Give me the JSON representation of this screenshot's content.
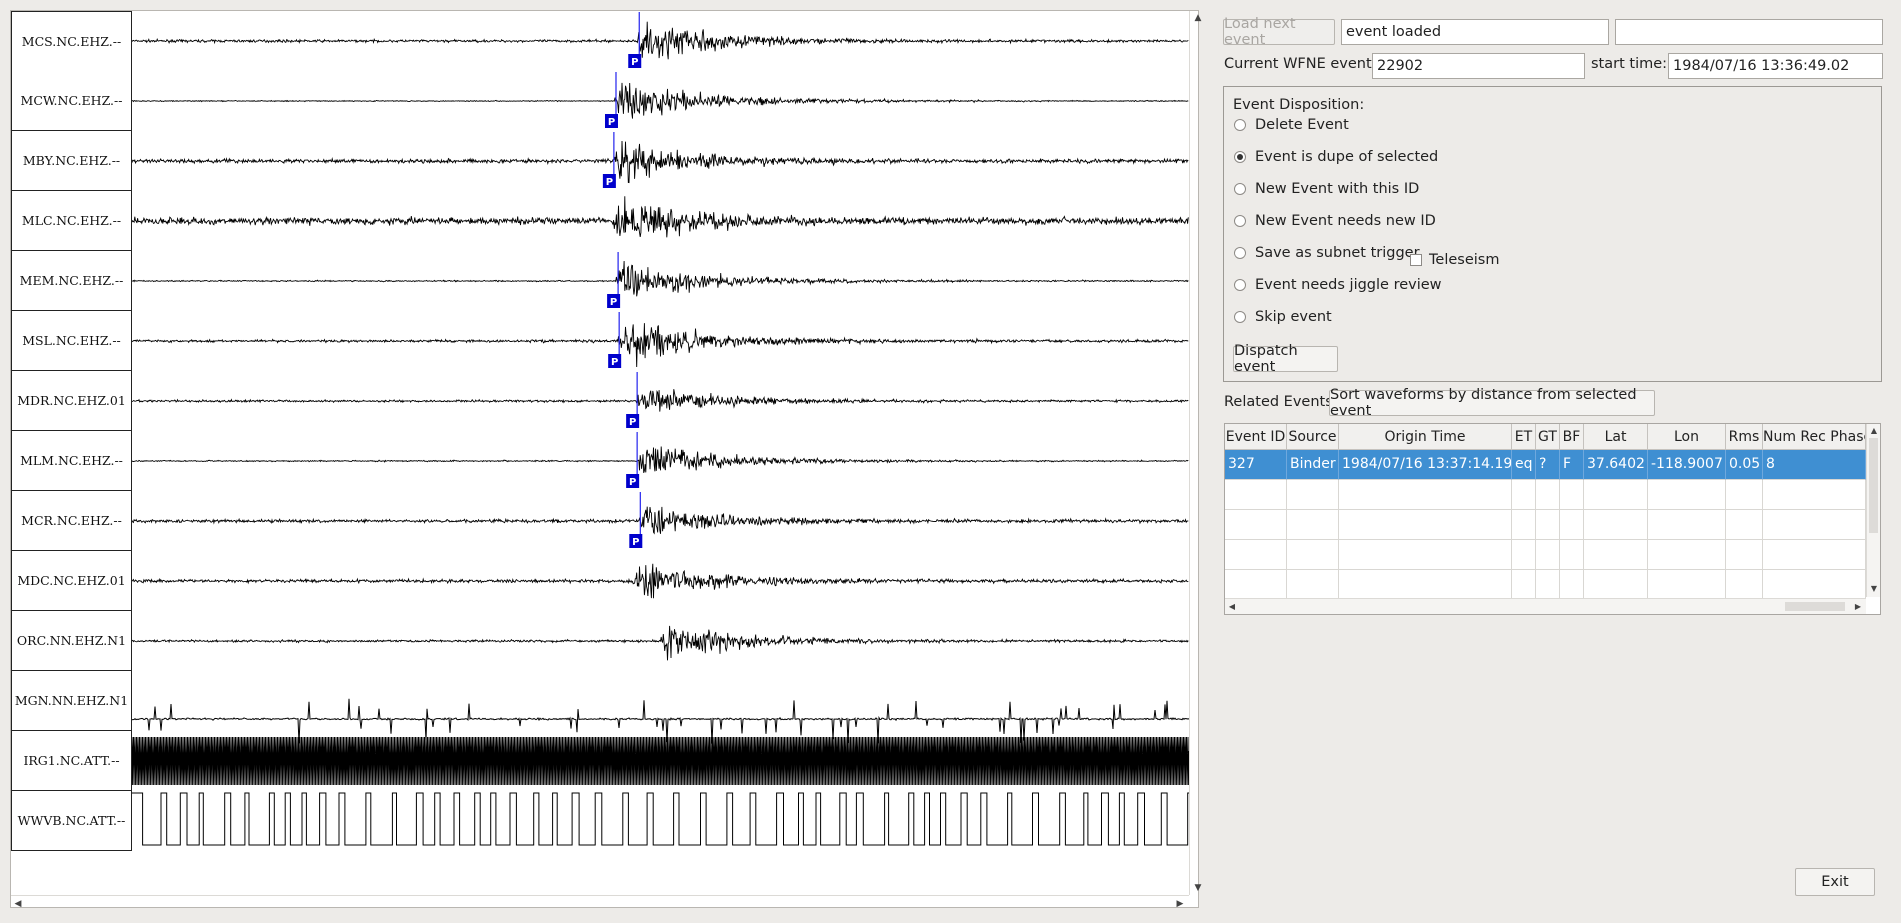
{
  "waveforms": {
    "stations": [
      {
        "label": "MCS.NC.EHZ.--",
        "pick": "P",
        "pick_time": 0.478,
        "onset": 0.478,
        "noise": 0.08,
        "amp": 0.9,
        "style": "quake"
      },
      {
        "label": "MCW.NC.EHZ.--",
        "pick": "P",
        "pick_time": 0.456,
        "onset": 0.456,
        "noise": 0.03,
        "amp": 0.8,
        "style": "quake"
      },
      {
        "label": "MBY.NC.EHZ.--",
        "pick": "P",
        "pick_time": 0.454,
        "onset": 0.456,
        "noise": 0.12,
        "amp": 0.8,
        "style": "quake"
      },
      {
        "label": "MLC.NC.EHZ.--",
        "pick": "",
        "pick_time": null,
        "onset": 0.455,
        "noise": 0.22,
        "amp": 0.85,
        "style": "quake"
      },
      {
        "label": "MEM.NC.EHZ.--",
        "pick": "P",
        "pick_time": 0.458,
        "onset": 0.458,
        "noise": 0.04,
        "amp": 0.8,
        "style": "quake"
      },
      {
        "label": "MSL.NC.EHZ.--",
        "pick": "P",
        "pick_time": 0.459,
        "onset": 0.46,
        "noise": 0.08,
        "amp": 0.85,
        "style": "quake"
      },
      {
        "label": "MDR.NC.EHZ.01",
        "pick": "P",
        "pick_time": 0.476,
        "onset": 0.476,
        "noise": 0.07,
        "amp": 0.55,
        "style": "quake"
      },
      {
        "label": "MLM.NC.EHZ.--",
        "pick": "P",
        "pick_time": 0.476,
        "onset": 0.478,
        "noise": 0.04,
        "amp": 0.65,
        "style": "quake"
      },
      {
        "label": "MCR.NC.EHZ.--",
        "pick": "P",
        "pick_time": 0.479,
        "onset": 0.48,
        "noise": 0.1,
        "amp": 0.65,
        "style": "quake"
      },
      {
        "label": "MDC.NC.EHZ.01",
        "pick": "",
        "pick_time": null,
        "onset": 0.474,
        "noise": 0.1,
        "amp": 0.75,
        "style": "quake"
      },
      {
        "label": "ORC.NN.EHZ.N1",
        "pick": "",
        "pick_time": null,
        "onset": 0.5,
        "noise": 0.07,
        "amp": 0.7,
        "style": "quake"
      },
      {
        "label": "MGN.NN.EHZ.N1",
        "pick": "",
        "pick_time": null,
        "onset": null,
        "noise": 0.05,
        "amp": 0.7,
        "style": "spikes"
      },
      {
        "label": "IRG1.NC.ATT.--",
        "pick": "",
        "pick_time": null,
        "onset": null,
        "noise": 0,
        "amp": 0.9,
        "style": "dense"
      },
      {
        "label": "WWVB.NC.ATT.--",
        "pick": "",
        "pick_time": null,
        "onset": null,
        "noise": 0,
        "amp": 0.9,
        "style": "square"
      }
    ]
  },
  "controls": {
    "load_next_label": "Load next event",
    "status_value": "event loaded",
    "message_value": "",
    "current_event_label": "Current WFNE event:",
    "current_event_value": "22902",
    "start_time_label": "start time:",
    "start_time_value": "1984/07/16 13:36:49.02"
  },
  "disposition": {
    "title": "Event Disposition:",
    "options": [
      {
        "label": "Delete Event",
        "selected": false
      },
      {
        "label": "Event is dupe of selected",
        "selected": true
      },
      {
        "label": "New Event with this ID",
        "selected": false
      },
      {
        "label": "New Event needs new ID",
        "selected": false
      },
      {
        "label": "Save as subnet trigger",
        "selected": false
      },
      {
        "label": "Event needs jiggle review",
        "selected": false
      },
      {
        "label": "Skip event",
        "selected": false
      }
    ],
    "teleseism_label": "Teleseism",
    "teleseism_checked": false,
    "dispatch_label": "Dispatch event"
  },
  "related": {
    "label": "Related Events:",
    "sort_button_label": "Sort waveforms by distance from selected event",
    "columns": [
      "Event ID",
      "Source",
      "Origin Time",
      "ET",
      "GT",
      "BF",
      "Lat",
      "Lon",
      "Rms",
      "Num Rec Phase"
    ],
    "rows": [
      [
        "327",
        "Binder",
        "1984/07/16 13:37:14.19",
        "eq",
        "?",
        "F",
        "37.6402",
        "-118.9007",
        "0.05",
        "8"
      ]
    ],
    "empty_rows": 4
  },
  "exit_label": "Exit",
  "colors": {
    "selection": "#3f8fd2",
    "pick_marker": "#0000cc",
    "pick_line": "#2222ee",
    "background": "#edebe8"
  }
}
